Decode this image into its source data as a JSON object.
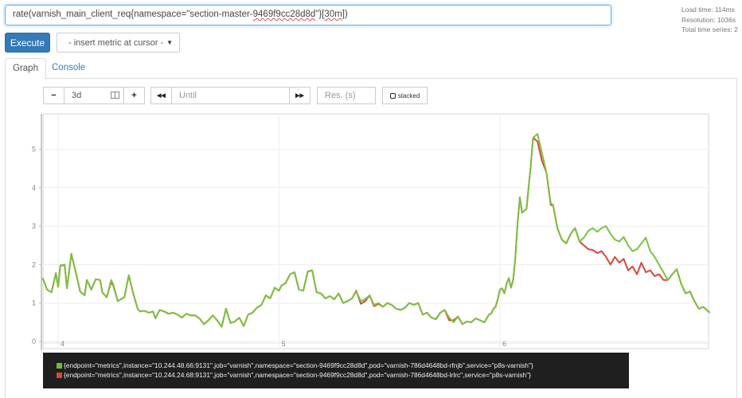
{
  "query": {
    "prefix": "rate(varnish_main_client_req{namespace=\"section-master-",
    "underlined_hash": "9469f9cc28d8d",
    "middle": "\"}[",
    "underlined_range": "30m",
    "suffix": "])"
  },
  "stats": {
    "load_time": "Load time: 114ms",
    "resolution": "Resolution: 1036s",
    "total_series": "Total time series: 2"
  },
  "execute_label": "Execute",
  "metric_select": {
    "label": "- insert metric at cursor -",
    "caret": "▼"
  },
  "tabs": [
    {
      "label": "Graph",
      "active": true
    },
    {
      "label": "Console",
      "active": false
    }
  ],
  "controls": {
    "minus": "−",
    "range_value": "3d",
    "plus": "+",
    "back": "◀◀",
    "until_placeholder": "Until",
    "forward": "▶▶",
    "res_placeholder": "Res. (s)",
    "stacked_label": "stacked"
  },
  "colors": {
    "series1": "#7cc142",
    "series2": "#d9463b",
    "accent": "#337ab7"
  },
  "legend": [
    {
      "color": "#6abe2f",
      "label": "{endpoint=\"metrics\",instance=\"10.244.48.66:9131\",job=\"varnish\",namespace=\"section-9469f9cc28d8d\",pod=\"varnish-786d4648bd-rfnjb\",service=\"p8s-varnish\"}"
    },
    {
      "color": "#d9463b",
      "label": "{endpoint=\"metrics\",instance=\"10.244.24.68:9131\",job=\"varnish\",namespace=\"section-9469f9cc28d8d\",pod=\"varnish-786d4648bd-lrlrc\",service=\"p8s-varnish\"}"
    }
  ],
  "chart_data": {
    "type": "line",
    "title": "",
    "xlabel": "",
    "ylabel": "",
    "x_unit": "day",
    "xlim": [
      3.93,
      6.95
    ],
    "ylim": [
      0,
      5.9
    ],
    "x_ticks": [
      4,
      5,
      6
    ],
    "x_tick_labels": [
      "4",
      "5",
      "6"
    ],
    "y_ticks": [
      0,
      1,
      2,
      3,
      4,
      5
    ],
    "y_tick_labels": [
      "0",
      "1",
      "2",
      "3",
      "4",
      "5"
    ],
    "grid": true,
    "legend_position": "bottom",
    "series": [
      {
        "name": "{endpoint=\"metrics\",instance=\"10.244.48.66:9131\",job=\"varnish\",namespace=\"section-9469f9cc28d8d\",pod=\"varnish-786d4648bd-rfnjb\",service=\"p8s-varnish\"}",
        "x": [
          3.93,
          3.95,
          3.97,
          3.99,
          4.0,
          4.01,
          4.03,
          4.04,
          4.06,
          4.08,
          4.1,
          4.12,
          4.13,
          4.15,
          4.17,
          4.19,
          4.2,
          4.22,
          4.24,
          4.25,
          4.27,
          4.29,
          4.3,
          4.32,
          4.34,
          4.36,
          4.37,
          4.39,
          4.41,
          4.43,
          4.44,
          4.46,
          4.48,
          4.5,
          4.52,
          4.54,
          4.56,
          4.58,
          4.6,
          4.62,
          4.64,
          4.66,
          4.68,
          4.7,
          4.72,
          4.74,
          4.76,
          4.78,
          4.8,
          4.82,
          4.84,
          4.86,
          4.88,
          4.9,
          4.92,
          4.94,
          4.96,
          4.98,
          5.0,
          5.01,
          5.03,
          5.05,
          5.07,
          5.09,
          5.11,
          5.13,
          5.15,
          5.17,
          5.19,
          5.21,
          5.23,
          5.25,
          5.27,
          5.29,
          5.31,
          5.33,
          5.35,
          5.37,
          5.39,
          5.41,
          5.43,
          5.45,
          5.47,
          5.49,
          5.51,
          5.53,
          5.55,
          5.57,
          5.59,
          5.61,
          5.63,
          5.65,
          5.67,
          5.69,
          5.71,
          5.73,
          5.75,
          5.77,
          5.79,
          5.81,
          5.83,
          5.85,
          5.87,
          5.89,
          5.91,
          5.93,
          5.95,
          5.96,
          5.97,
          5.98,
          5.99,
          6.0,
          6.01,
          6.02,
          6.03,
          6.04,
          6.05,
          6.06,
          6.07,
          6.08,
          6.09,
          6.1,
          6.12,
          6.14,
          6.15,
          6.17,
          6.19,
          6.21,
          6.23,
          6.24,
          6.26,
          6.28,
          6.3,
          6.32,
          6.34,
          6.36,
          6.38,
          6.4,
          6.42,
          6.44,
          6.46,
          6.48,
          6.5,
          6.52,
          6.54,
          6.56,
          6.58,
          6.6,
          6.62,
          6.64,
          6.66,
          6.68,
          6.7,
          6.72,
          6.74,
          6.76,
          6.78,
          6.8,
          6.82,
          6.84,
          6.86,
          6.88,
          6.9,
          6.92,
          6.95
        ],
        "values": [
          1.65,
          1.35,
          1.28,
          1.78,
          1.42,
          1.98,
          2.0,
          1.38,
          2.28,
          1.8,
          1.3,
          1.2,
          1.6,
          1.35,
          1.62,
          1.6,
          1.28,
          1.15,
          1.6,
          1.48,
          1.05,
          1.12,
          1.15,
          1.72,
          1.25,
          0.85,
          0.78,
          0.8,
          0.75,
          0.78,
          0.6,
          0.82,
          0.78,
          0.72,
          0.75,
          0.7,
          0.62,
          0.72,
          0.68,
          0.68,
          0.6,
          0.45,
          0.55,
          0.68,
          0.55,
          0.38,
          0.85,
          0.48,
          0.52,
          0.62,
          0.4,
          0.7,
          0.75,
          0.88,
          0.95,
          1.2,
          1.12,
          1.4,
          1.32,
          1.45,
          1.52,
          1.75,
          1.8,
          1.35,
          1.32,
          1.82,
          1.85,
          1.28,
          1.25,
          1.12,
          1.18,
          1.1,
          1.25,
          1.0,
          1.05,
          1.12,
          1.3,
          1.05,
          1.1,
          1.2,
          0.95,
          1.0,
          0.9,
          1.0,
          0.95,
          0.85,
          0.82,
          0.88,
          1.0,
          0.95,
          1.0,
          0.7,
          0.75,
          0.62,
          0.58,
          0.75,
          0.82,
          0.62,
          0.5,
          0.65,
          0.45,
          0.52,
          0.5,
          0.6,
          0.55,
          0.5,
          0.7,
          0.72,
          0.85,
          0.9,
          1.1,
          1.35,
          1.38,
          1.25,
          1.5,
          1.65,
          1.4,
          1.6,
          2.2,
          3.1,
          3.75,
          3.35,
          3.45,
          4.6,
          5.3,
          5.4,
          4.9,
          4.4,
          3.6,
          3.55,
          2.95,
          2.65,
          2.55,
          2.8,
          2.95,
          2.6,
          2.7,
          2.88,
          2.95,
          2.85,
          2.95,
          3.0,
          2.8,
          2.65,
          2.6,
          2.72,
          2.5,
          2.35,
          2.4,
          2.55,
          2.7,
          2.35,
          2.2,
          2.0,
          1.8,
          1.6,
          1.75,
          1.88,
          1.5,
          1.25,
          1.3,
          1.05,
          0.85,
          0.9,
          0.75,
          0.72,
          0.78,
          0.72,
          0.75,
          1.05,
          0.6,
          0.78,
          0.72,
          0.62,
          0.92,
          1.1,
          1.35,
          1.55,
          1.65,
          1.6,
          1.7
        ]
      },
      {
        "name": "{endpoint=\"metrics\",instance=\"10.244.24.68:9131\",job=\"varnish\",namespace=\"section-9469f9cc28d8d\",pod=\"varnish-786d4648bd-lrlrc\",service=\"p8s-varnish\"}",
        "x": [
          3.93,
          3.95,
          3.97,
          3.99,
          4.0,
          4.01,
          4.03,
          4.04,
          4.06,
          4.08,
          4.1,
          4.12,
          4.13,
          4.15,
          4.17,
          4.19,
          4.2,
          4.22,
          4.24,
          4.25,
          4.27,
          4.29,
          4.3,
          4.32,
          4.34,
          4.36,
          4.37,
          4.39,
          4.41,
          4.43,
          4.44,
          4.46,
          4.48,
          4.5,
          4.52,
          4.54,
          4.56,
          4.58,
          4.6,
          4.62,
          4.64,
          4.66,
          4.68,
          4.7,
          4.72,
          4.74,
          4.76,
          4.78,
          4.8,
          4.82,
          4.84,
          4.86,
          4.88,
          4.9,
          4.92,
          4.94,
          4.96,
          4.98,
          5.0,
          5.01,
          5.03,
          5.05,
          5.07,
          5.09,
          5.11,
          5.13,
          5.15,
          5.17,
          5.19,
          5.21,
          5.23,
          5.25,
          5.27,
          5.29,
          5.31,
          5.33,
          5.35,
          5.37,
          5.39,
          5.41,
          5.43,
          5.45,
          5.47,
          5.49,
          5.51,
          5.53,
          5.55,
          5.57,
          5.59,
          5.61,
          5.63,
          5.65,
          5.67,
          5.69,
          5.71,
          5.73,
          5.75,
          5.77,
          5.79,
          5.81,
          5.83,
          5.85,
          5.87,
          5.89,
          5.91,
          5.93,
          5.95,
          5.96,
          5.97,
          5.98,
          5.99,
          6.0,
          6.01,
          6.02,
          6.03,
          6.04,
          6.05,
          6.06,
          6.07,
          6.08,
          6.09,
          6.1,
          6.12,
          6.14,
          6.15,
          6.17,
          6.19,
          6.21,
          6.23,
          6.24,
          6.26,
          6.28,
          6.3,
          6.32,
          6.34,
          6.36,
          6.38,
          6.4,
          6.42,
          6.44,
          6.46,
          6.48,
          6.5,
          6.52,
          6.54,
          6.56,
          6.58,
          6.6,
          6.62,
          6.64,
          6.66,
          6.68,
          6.7,
          6.72,
          6.74,
          6.76,
          6.78,
          6.8,
          6.82,
          6.84,
          6.86,
          6.88,
          6.9,
          6.92,
          6.95
        ],
        "values": [
          1.65,
          1.35,
          1.28,
          1.78,
          1.42,
          1.98,
          1.98,
          1.38,
          2.28,
          1.8,
          1.3,
          1.2,
          1.6,
          1.35,
          1.62,
          1.6,
          1.28,
          1.15,
          1.55,
          1.45,
          1.05,
          1.12,
          1.15,
          1.72,
          1.25,
          0.85,
          0.78,
          0.8,
          0.75,
          0.78,
          0.6,
          0.82,
          0.78,
          0.72,
          0.75,
          0.7,
          0.62,
          0.72,
          0.68,
          0.68,
          0.6,
          0.45,
          0.55,
          0.68,
          0.55,
          0.38,
          0.85,
          0.48,
          0.52,
          0.62,
          0.4,
          0.7,
          0.75,
          0.88,
          0.95,
          1.2,
          1.12,
          1.4,
          1.32,
          1.45,
          1.52,
          1.75,
          1.8,
          1.35,
          1.32,
          1.82,
          1.85,
          1.28,
          1.25,
          1.12,
          1.18,
          1.1,
          1.25,
          1.0,
          1.05,
          1.12,
          1.32,
          0.98,
          1.05,
          1.2,
          0.92,
          0.98,
          0.9,
          1.0,
          0.95,
          0.85,
          0.82,
          0.88,
          1.0,
          0.95,
          1.0,
          0.7,
          0.75,
          0.62,
          0.58,
          0.75,
          0.82,
          0.55,
          0.55,
          0.65,
          0.45,
          0.52,
          0.5,
          0.6,
          0.55,
          0.5,
          0.7,
          0.72,
          0.85,
          0.9,
          1.1,
          1.35,
          1.38,
          1.25,
          1.5,
          1.65,
          1.4,
          1.6,
          2.2,
          3.1,
          3.75,
          3.35,
          3.45,
          4.6,
          5.3,
          5.2,
          4.7,
          4.4,
          3.55,
          3.55,
          2.95,
          2.65,
          2.55,
          2.8,
          2.95,
          2.6,
          2.5,
          2.4,
          2.38,
          2.3,
          2.35,
          2.2,
          2.0,
          2.2,
          2.05,
          2.15,
          1.85,
          1.95,
          1.75,
          2.05,
          1.8,
          1.85,
          1.7,
          1.75,
          1.6,
          1.6,
          1.75,
          1.88,
          1.5,
          1.25,
          1.3,
          1.05,
          0.85,
          0.9,
          0.75,
          0.72,
          0.78,
          0.72,
          0.75,
          1.05,
          0.6,
          0.82,
          0.78,
          0.62,
          0.92,
          1.1,
          1.35,
          1.55,
          1.65,
          1.6,
          1.65
        ]
      }
    ]
  }
}
